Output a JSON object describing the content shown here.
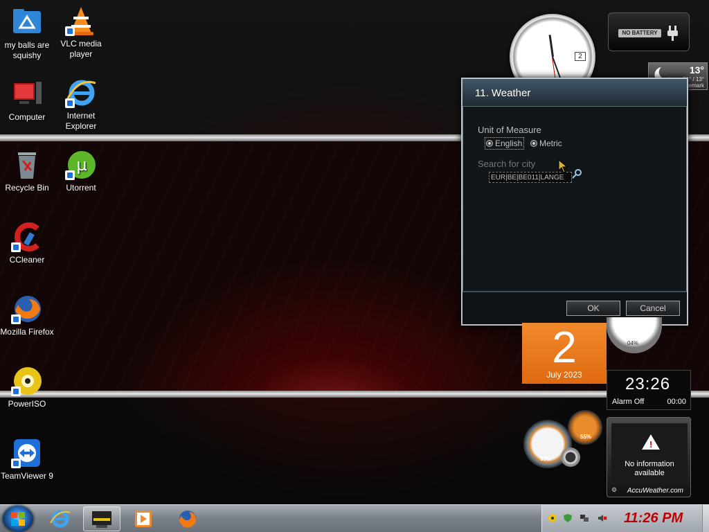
{
  "desktop_icons": [
    {
      "label": "my balls are squishy",
      "icon": "folder-icon"
    },
    {
      "label": "VLC media player",
      "icon": "vlc-icon"
    },
    {
      "label": "Computer",
      "icon": "computer-icon"
    },
    {
      "label": "Internet Explorer",
      "icon": "ie-icon"
    },
    {
      "label": "Recycle Bin",
      "icon": "recycle-bin-icon"
    },
    {
      "label": "Utorrent",
      "icon": "utorrent-icon"
    },
    {
      "label": "CCleaner",
      "icon": "ccleaner-icon"
    },
    {
      "label": "Mozilla Firefox",
      "icon": "firefox-icon"
    },
    {
      "label": "PowerISO",
      "icon": "poweriso-icon"
    },
    {
      "label": "TeamViewer 9",
      "icon": "teamviewer-icon"
    }
  ],
  "clock_gadget": {
    "date": "2"
  },
  "battery_gadget": {
    "label": "NO BATTERY"
  },
  "weather_mini": {
    "temp": "13°",
    "range": "21° / 13°",
    "city": "Langemark"
  },
  "dialog": {
    "title": "11. Weather",
    "unit_label": "Unit of Measure",
    "option_english": "English",
    "option_metric": "Metric",
    "selected_unit": "English",
    "search_label": "Search for city",
    "city_value": "EUR|BE|BE011|LANGE",
    "ok": "OK",
    "cancel": "Cancel"
  },
  "calendar_gadget": {
    "day": "2",
    "month": "July 2023"
  },
  "gauge_gadget": {
    "percent": "04%"
  },
  "alarm_gadget": {
    "time": "23:26",
    "status": "Alarm Off",
    "alarm_time": "00:00"
  },
  "cpu_gadget": {
    "cpu": "09%",
    "memory": "55%"
  },
  "accuweather": {
    "message": "No information available",
    "brand": "AccuWeather.com"
  },
  "taskbar": {
    "time": "11:26 PM",
    "pinned": [
      "internet-explorer",
      "cpu-meter",
      "media-player",
      "firefox"
    ]
  },
  "colors": {
    "accent_red": "#c00000",
    "calendar_orange": "#e86e14"
  }
}
